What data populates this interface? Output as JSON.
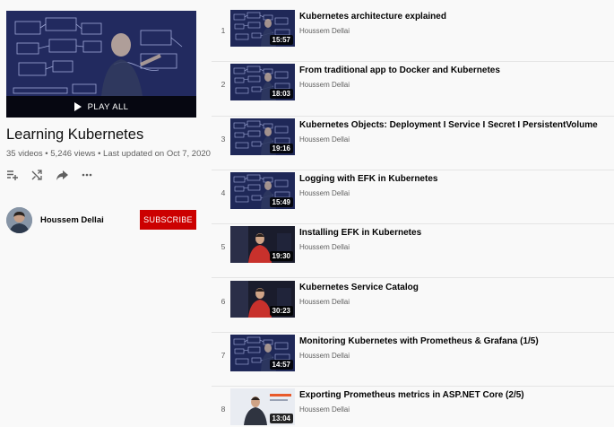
{
  "playlist": {
    "play_all_label": "PLAY ALL",
    "title": "Learning Kubernetes",
    "stats": "35 videos • 5,246 views • Last updated on Oct 7, 2020",
    "owner": "Houssem Dellai",
    "subscribe_label": "SUBSCRIBE"
  },
  "actions": [
    {
      "name": "add-to-queue-icon"
    },
    {
      "name": "shuffle-icon"
    },
    {
      "name": "share-icon"
    },
    {
      "name": "more-icon"
    }
  ],
  "videos": [
    {
      "index": "1",
      "title": "Kubernetes architecture explained",
      "owner": "Houssem Dellai",
      "duration": "15:57",
      "thumb_style": "diagram"
    },
    {
      "index": "2",
      "title": "From traditional app to Docker and Kubernetes",
      "owner": "Houssem Dellai",
      "duration": "18:03",
      "thumb_style": "diagram"
    },
    {
      "index": "3",
      "title": "Kubernetes Objects: Deployment I Service I Secret I PersistentVolume",
      "owner": "Houssem Dellai",
      "duration": "19:16",
      "thumb_style": "diagram"
    },
    {
      "index": "4",
      "title": "Logging with EFK in Kubernetes",
      "owner": "Houssem Dellai",
      "duration": "15:49",
      "thumb_style": "diagram"
    },
    {
      "index": "5",
      "title": "Installing EFK in Kubernetes",
      "owner": "Houssem Dellai",
      "duration": "19:30",
      "thumb_style": "person-dark"
    },
    {
      "index": "6",
      "title": "Kubernetes Service Catalog",
      "owner": "Houssem Dellai",
      "duration": "30:23",
      "thumb_style": "person-dark"
    },
    {
      "index": "7",
      "title": "Monitoring Kubernetes with Prometheus & Grafana (1/5)",
      "owner": "Houssem Dellai",
      "duration": "14:57",
      "thumb_style": "diagram"
    },
    {
      "index": "8",
      "title": "Exporting Prometheus metrics in ASP.NET Core (2/5)",
      "owner": "Houssem Dellai",
      "duration": "13:04",
      "thumb_style": "person-light"
    }
  ],
  "colors": {
    "subscribe": "#cc0000",
    "background": "#f9f9f9",
    "thumb_dark": "#1c2448"
  }
}
